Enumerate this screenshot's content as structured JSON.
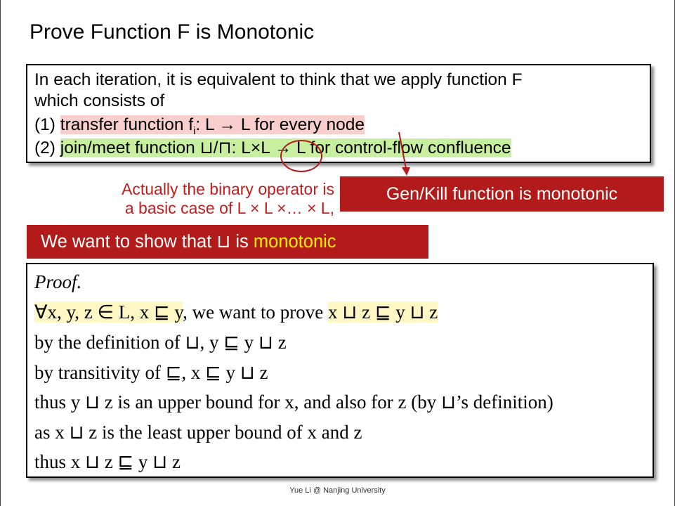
{
  "title": "Prove Function F is Monotonic",
  "intro": {
    "line1": "In each iteration, it is equivalent to think that we apply function F",
    "line2": "which consists of",
    "item1_num": "(1)",
    "item1_highlight": "transfer function f",
    "item1_sub": "i",
    "item1_rest": ": L → L for every node",
    "item2_num": "(2)",
    "item2_highlight_a": "join/meet function ⊔/⊓: ",
    "item2_highlight_b": "L×L",
    "item2_highlight_c": " → L for control-flow confluence"
  },
  "note": {
    "line1": "Actually the binary operator is",
    "line2": "a basic case of L × L ×… × L,"
  },
  "genkill_label": "Gen/Kill function is monotonic",
  "want": {
    "prefix": "We want to show that ⊔ is ",
    "highlight": "monotonic"
  },
  "proof": {
    "heading": "Proof.",
    "l2_hl": "∀x, y, z ∈ L, x ⊑ y",
    "l2_mid": ", we want to prove ",
    "l2_goal": "x ⊔ z ⊑ y ⊔ z",
    "l3": "by the definition of ⊔, y ⊑ y ⊔ z",
    "l4": "by transitivity of ⊑, x ⊑ y ⊔ z",
    "l5": "thus y ⊔ z is an upper bound for x, and also for z (by ⊔’s definition)",
    "l6": "as x ⊔ z is the least upper bound of x and z",
    "l7": "thus x ⊔ z ⊑ y ⊔ z"
  },
  "footer": "Yue Li @ Nanjing University",
  "colors": {
    "accent_red": "#b31b1b",
    "note_red": "#c21d1d",
    "pink_highlight": "#f8cfcc",
    "green_highlight": "#c7ef9f",
    "yellow_highlight": "#fff8c4",
    "yellow_text": "#fff200"
  }
}
